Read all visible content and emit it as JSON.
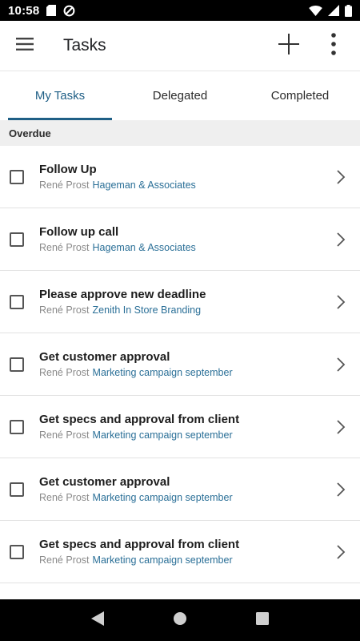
{
  "status_bar": {
    "time": "10:58"
  },
  "app_bar": {
    "title": "Tasks"
  },
  "tabs": [
    {
      "label": "My Tasks",
      "active": true
    },
    {
      "label": "Delegated",
      "active": false
    },
    {
      "label": "Completed",
      "active": false
    }
  ],
  "section": {
    "title": "Overdue"
  },
  "tasks": [
    {
      "title": "Follow Up",
      "owner": "René Prost",
      "related": "Hageman & Associates"
    },
    {
      "title": "Follow up call",
      "owner": "René Prost",
      "related": "Hageman & Associates"
    },
    {
      "title": "Please approve new deadline",
      "owner": "René Prost",
      "related": "Zenith In Store Branding"
    },
    {
      "title": "Get customer approval",
      "owner": "René Prost",
      "related": "Marketing campaign september"
    },
    {
      "title": "Get specs and approval from client",
      "owner": "René Prost",
      "related": "Marketing campaign september"
    },
    {
      "title": "Get customer approval",
      "owner": "René Prost",
      "related": "Marketing campaign september"
    },
    {
      "title": "Get specs and approval from client",
      "owner": "René Prost",
      "related": "Marketing campaign september"
    }
  ],
  "colors": {
    "accent": "#1f5f86",
    "link": "#2a6f97"
  },
  "icons": {
    "status_left": [
      "sd-card-icon",
      "do-not-disturb-icon"
    ],
    "status_right": [
      "wifi-icon",
      "cell-signal-icon",
      "battery-icon"
    ],
    "app_bar": [
      "menu-icon",
      "add-icon",
      "more-vert-icon"
    ],
    "nav": [
      "back-icon",
      "home-icon",
      "recents-icon"
    ]
  }
}
